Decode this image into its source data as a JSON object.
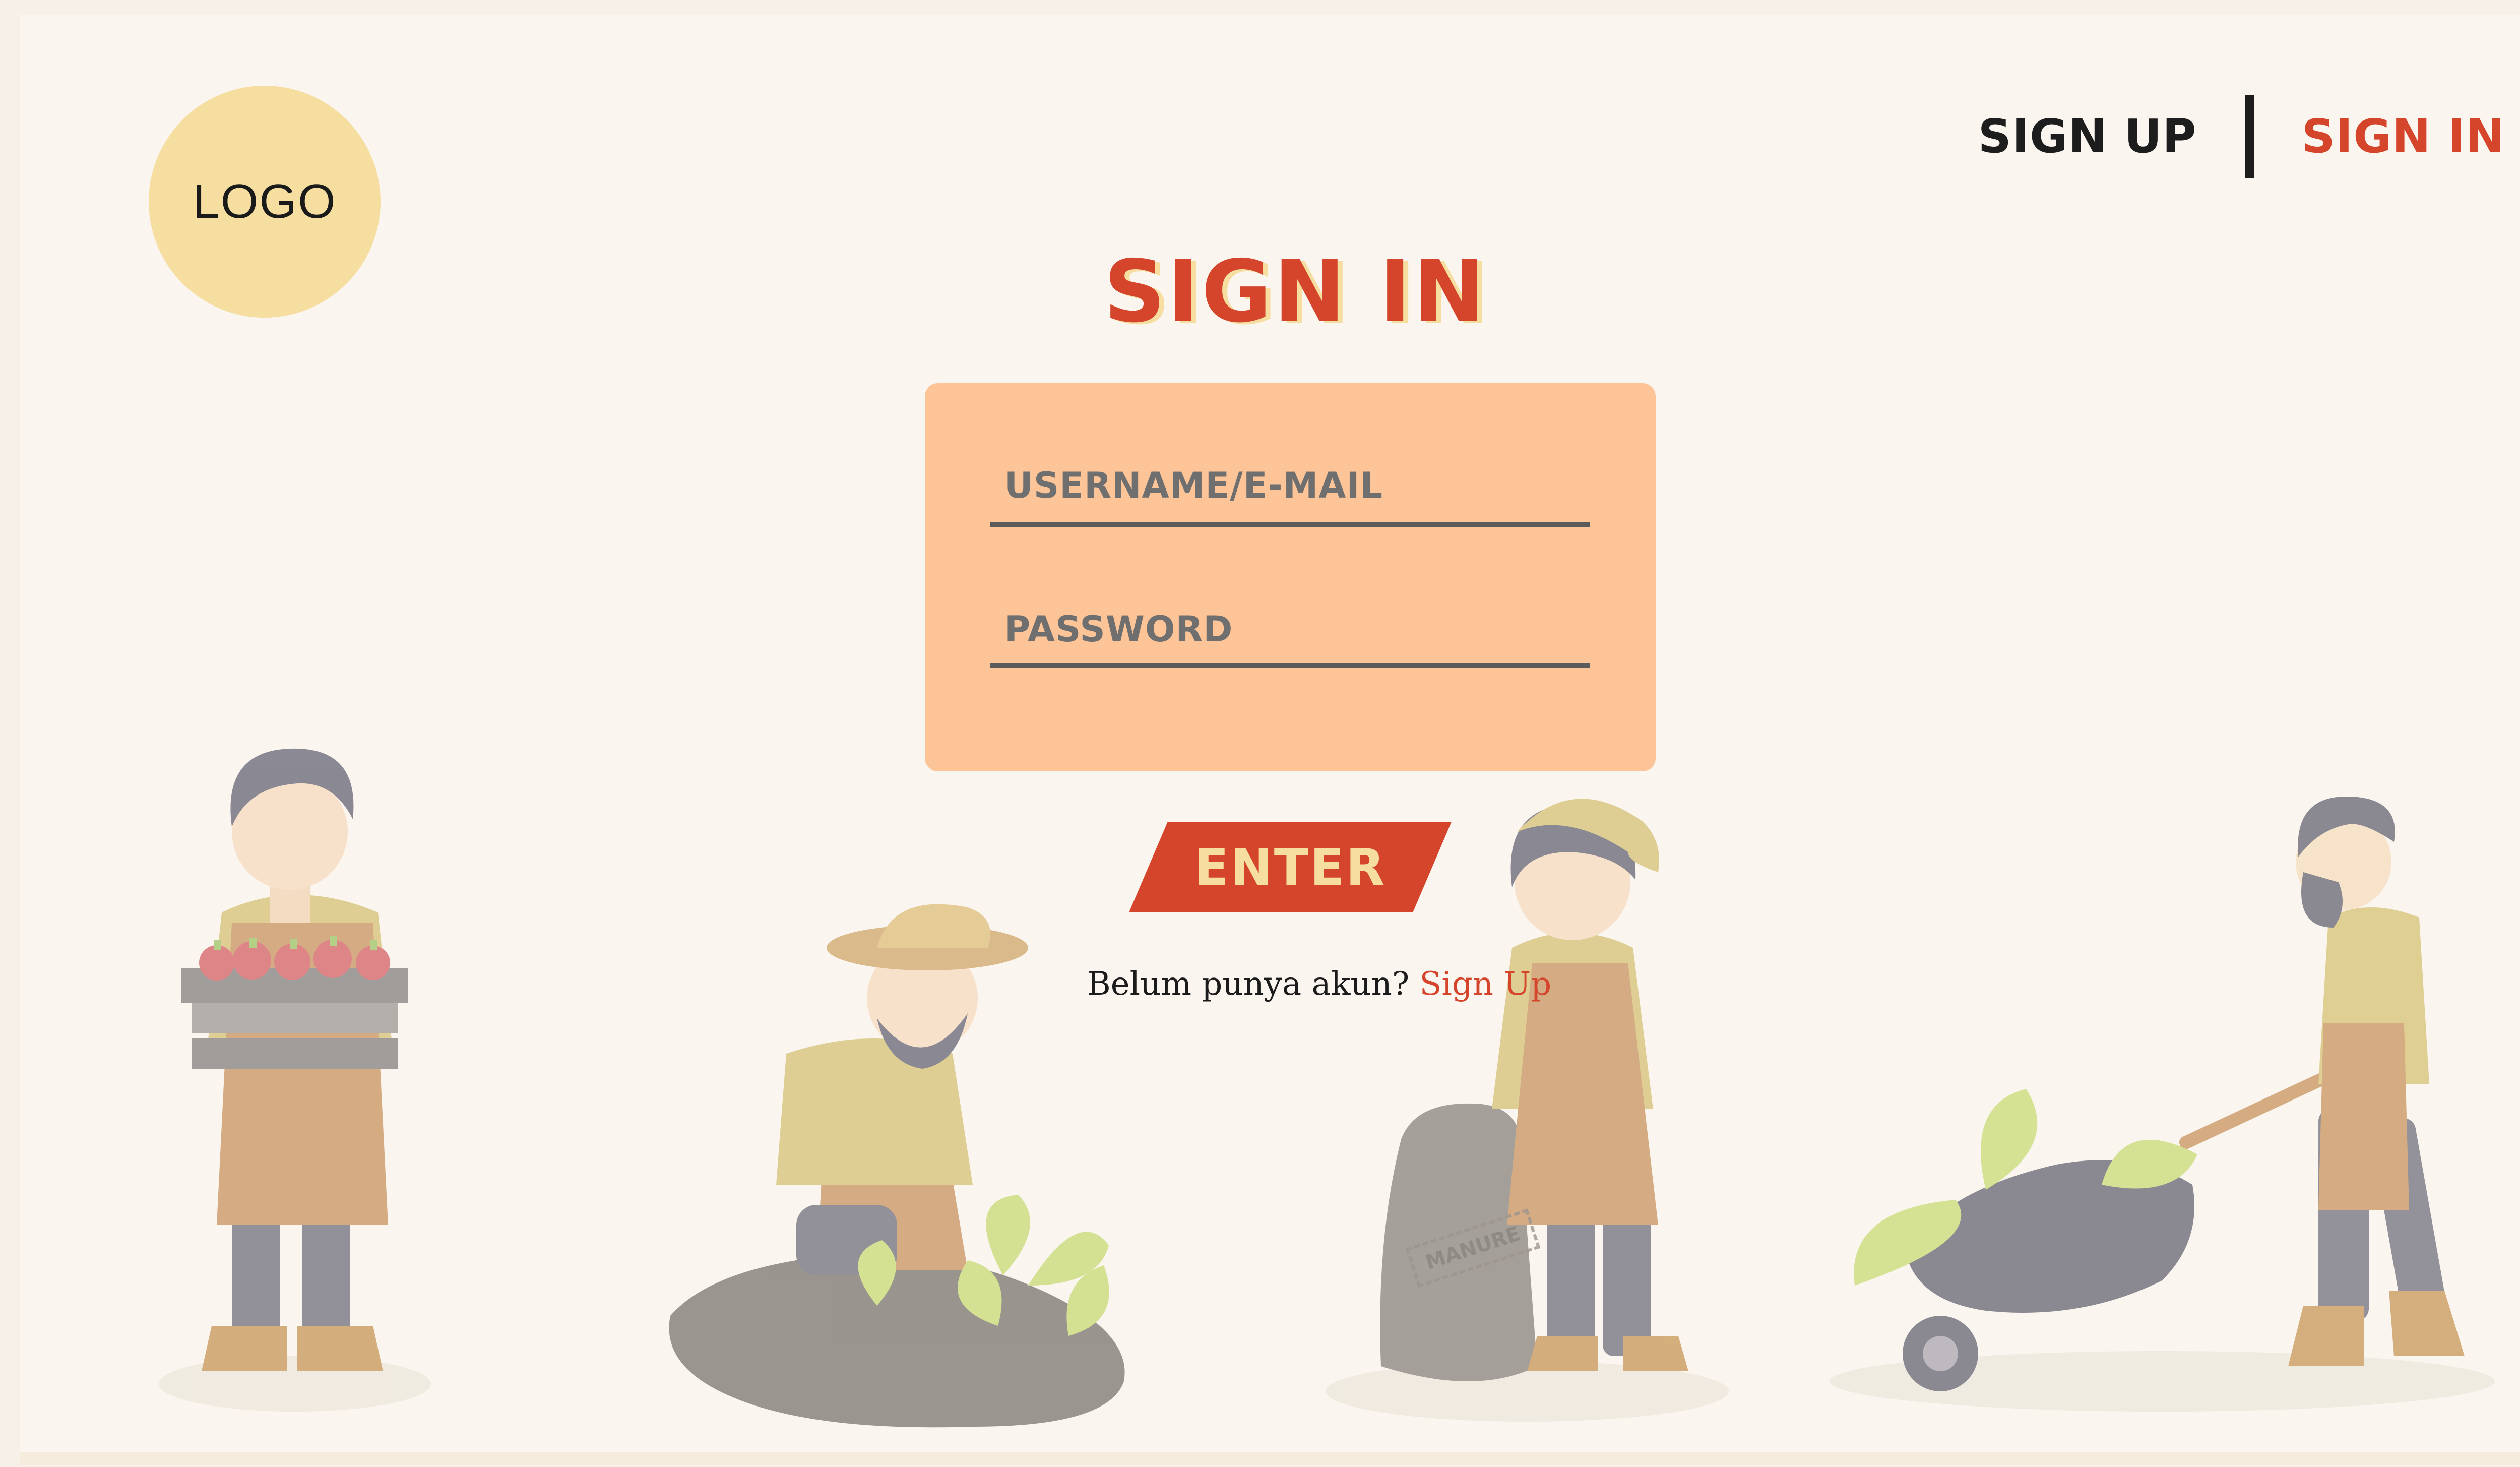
{
  "logo": {
    "text": "LOGO"
  },
  "nav": {
    "signup_label": "SIGN UP",
    "signin_label": "SIGN IN"
  },
  "form": {
    "title": "SIGN IN",
    "username": {
      "placeholder": "USERNAME/E-MAIL",
      "value": ""
    },
    "password": {
      "placeholder": "PASSWORD",
      "value": ""
    },
    "enter_label": "ENTER",
    "prompt_text": "Belum punya akun?",
    "prompt_link": "Sign Up"
  },
  "illustrations": {
    "sack_label": "MANURE"
  },
  "colors": {
    "accent": "#d4452b",
    "card": "#fdc498",
    "logo_bg": "#f6dda0",
    "background": "#faf5ee"
  }
}
